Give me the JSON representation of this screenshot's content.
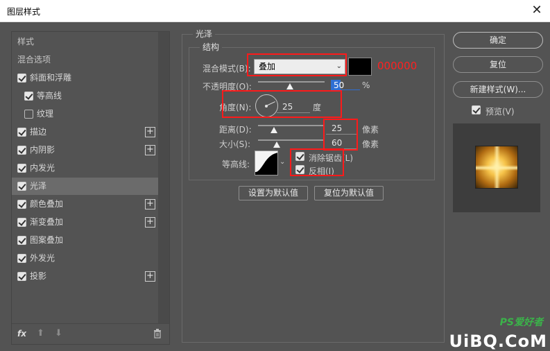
{
  "window": {
    "title": "图层样式",
    "close": "✕"
  },
  "styles_panel": {
    "header": "样式",
    "items": [
      {
        "label": "混合选项",
        "type": "header"
      },
      {
        "label": "斜面和浮雕",
        "checked": true
      },
      {
        "label": "等高线",
        "checked": true,
        "indent": true
      },
      {
        "label": "纹理",
        "checked": false,
        "indent": true
      },
      {
        "label": "描边",
        "checked": true,
        "plus": true
      },
      {
        "label": "内阴影",
        "checked": true,
        "plus": true
      },
      {
        "label": "内发光",
        "checked": true
      },
      {
        "label": "光泽",
        "checked": true,
        "selected": true
      },
      {
        "label": "颜色叠加",
        "checked": true,
        "plus": true
      },
      {
        "label": "渐变叠加",
        "checked": true,
        "plus": true
      },
      {
        "label": "图案叠加",
        "checked": true
      },
      {
        "label": "外发光",
        "checked": true
      },
      {
        "label": "投影",
        "checked": true,
        "plus": true
      }
    ],
    "fx_label": "fx"
  },
  "satin": {
    "group_title": "光泽",
    "structure_title": "结构",
    "blend_mode_label": "混合模式(B):",
    "blend_mode_value": "叠加",
    "color_hex_note": "000000",
    "opacity_label": "不透明度(O):",
    "opacity_value": "50",
    "opacity_unit": "%",
    "angle_label": "角度(N):",
    "angle_value": "25",
    "angle_unit": "度",
    "distance_label": "距离(D):",
    "distance_value": "25",
    "distance_unit": "像素",
    "size_label": "大小(S):",
    "size_value": "60",
    "size_unit": "像素",
    "contour_label": "等高线:",
    "antialias_label": "消除锯齿(L)",
    "antialias_checked": true,
    "invert_label": "反相(I)",
    "invert_checked": true,
    "set_default_label": "设置为默认值",
    "reset_default_label": "复位为默认值"
  },
  "right_panel": {
    "ok_label": "确定",
    "reset_label": "复位",
    "new_style_label": "新建样式(W)...",
    "preview_label": "预览(V)",
    "preview_checked": true
  },
  "watermark": {
    "text": "UiBQ.CoM",
    "sub": "PS爱好者"
  },
  "colors": {
    "highlight": "#ff1a1a",
    "background": "#535353",
    "selected": "#6b6b6b"
  }
}
